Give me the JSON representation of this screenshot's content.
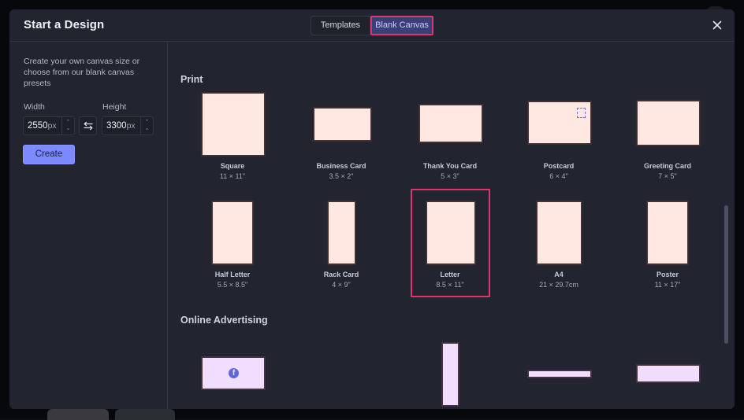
{
  "modal": {
    "title": "Start a Design",
    "tabs": [
      {
        "label": "Templates",
        "active": false
      },
      {
        "label": "Blank Canvas",
        "active": true
      }
    ],
    "close_icon": "close-icon"
  },
  "sidebar": {
    "intro": "Create your own canvas size or choose from our blank canvas presets",
    "width_label": "Width",
    "height_label": "Height",
    "width_value": "2550",
    "height_value": "3300",
    "unit": "px",
    "swap_icon": "swap-arrows-icon",
    "create_label": "Create"
  },
  "sections": [
    {
      "title": "Print",
      "presets": [
        {
          "name": "Square",
          "dims": "11 × 11\""
        },
        {
          "name": "Business Card",
          "dims": "3.5 × 2\""
        },
        {
          "name": "Thank You Card",
          "dims": "5 × 3\""
        },
        {
          "name": "Postcard",
          "dims": "6 × 4\""
        },
        {
          "name": "Greeting Card",
          "dims": "7 × 5\""
        },
        {
          "name": "Half Letter",
          "dims": "5.5 × 8.5\""
        },
        {
          "name": "Rack Card",
          "dims": "4 × 9\""
        },
        {
          "name": "Letter",
          "dims": "8.5 × 11\"",
          "selected": true
        },
        {
          "name": "A4",
          "dims": "21 × 29.7cm"
        },
        {
          "name": "Poster",
          "dims": "11 × 17\""
        }
      ]
    },
    {
      "title": "Online Advertising",
      "presets": [
        {
          "icon": "facebook-icon"
        },
        {},
        {},
        {},
        {}
      ]
    }
  ],
  "colors": {
    "accent": "#7c89ff",
    "highlight": "#e0336f",
    "print_preset": "#ffe8e2",
    "online_preset": "#f1deff"
  }
}
